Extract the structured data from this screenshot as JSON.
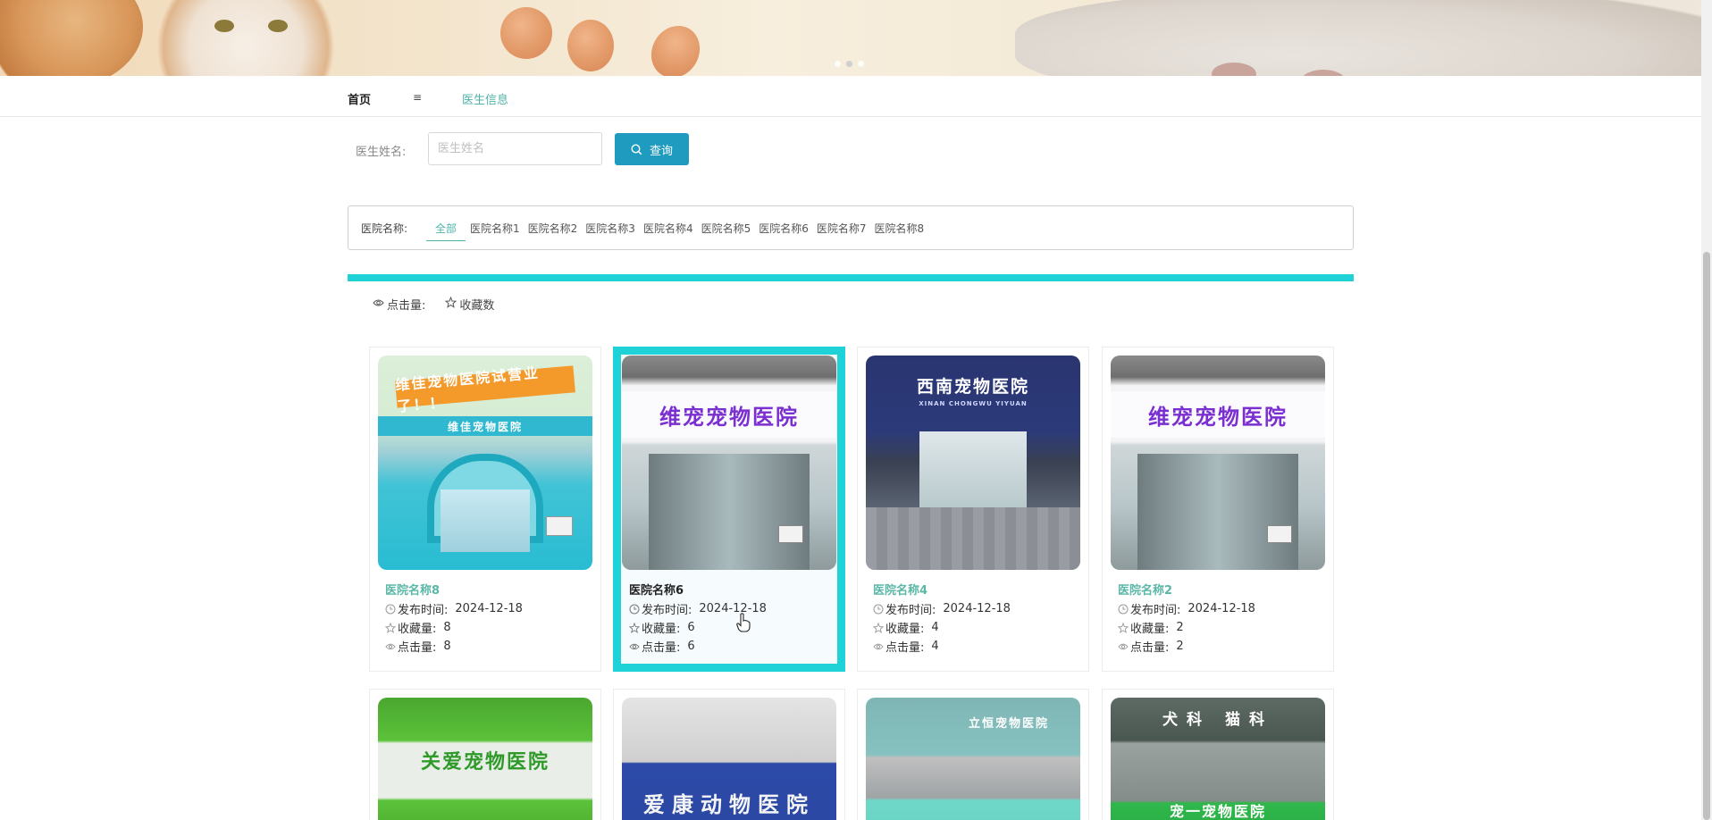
{
  "banner": {
    "slides": 3,
    "active_slide": 2
  },
  "nav": {
    "home": "首页",
    "separator": "≡",
    "current": "医生信息"
  },
  "search": {
    "label": "医生姓名:",
    "placeholder": "医生姓名",
    "value": "",
    "button_label": "查询"
  },
  "filter": {
    "label": "医院名称:",
    "items": [
      "全部",
      "医院名称1",
      "医院名称2",
      "医院名称3",
      "医院名称4",
      "医院名称5",
      "医院名称6",
      "医院名称7",
      "医院名称8"
    ],
    "active": "全部"
  },
  "sort": {
    "clicks_label": "点击量:",
    "favorites_label": "收藏数"
  },
  "labels": {
    "publish_time": "发布时间:",
    "favorites": "收藏量:",
    "clicks": "点击量:"
  },
  "cards": [
    {
      "name": "医院名称8",
      "date": "2024-12-18",
      "favorites": "8",
      "clicks": "8",
      "sign": "维佳宠物医院试营业了！！",
      "subsign": "维佳宠物医院"
    },
    {
      "name": "医院名称6",
      "date": "2024-12-18",
      "favorites": "6",
      "clicks": "6",
      "sign": "维宠宠物医院",
      "highlighted": true
    },
    {
      "name": "医院名称4",
      "date": "2024-12-18",
      "favorites": "4",
      "clicks": "4",
      "sign": "西南宠物医院",
      "subsign": "XINAN CHONGWU YIYUAN"
    },
    {
      "name": "医院名称2",
      "date": "2024-12-18",
      "favorites": "2",
      "clicks": "2",
      "sign": "维宠宠物医院"
    }
  ],
  "cards_row2": [
    {
      "sign": "关爱宠物医院"
    },
    {
      "sign": "爱康动物医院"
    },
    {
      "sign": "立恒宠物医院"
    },
    {
      "sign_top": "犬科 猫科",
      "sign": "宠一宠物医院"
    }
  ],
  "colors": {
    "accent_cyan": "#1fd2d8",
    "button_blue": "#1f9bbf",
    "link_green": "#4fb3a8"
  },
  "icons": {
    "search": "search-icon",
    "eye": "eye-icon",
    "star": "star-icon",
    "clock": "clock-icon"
  }
}
